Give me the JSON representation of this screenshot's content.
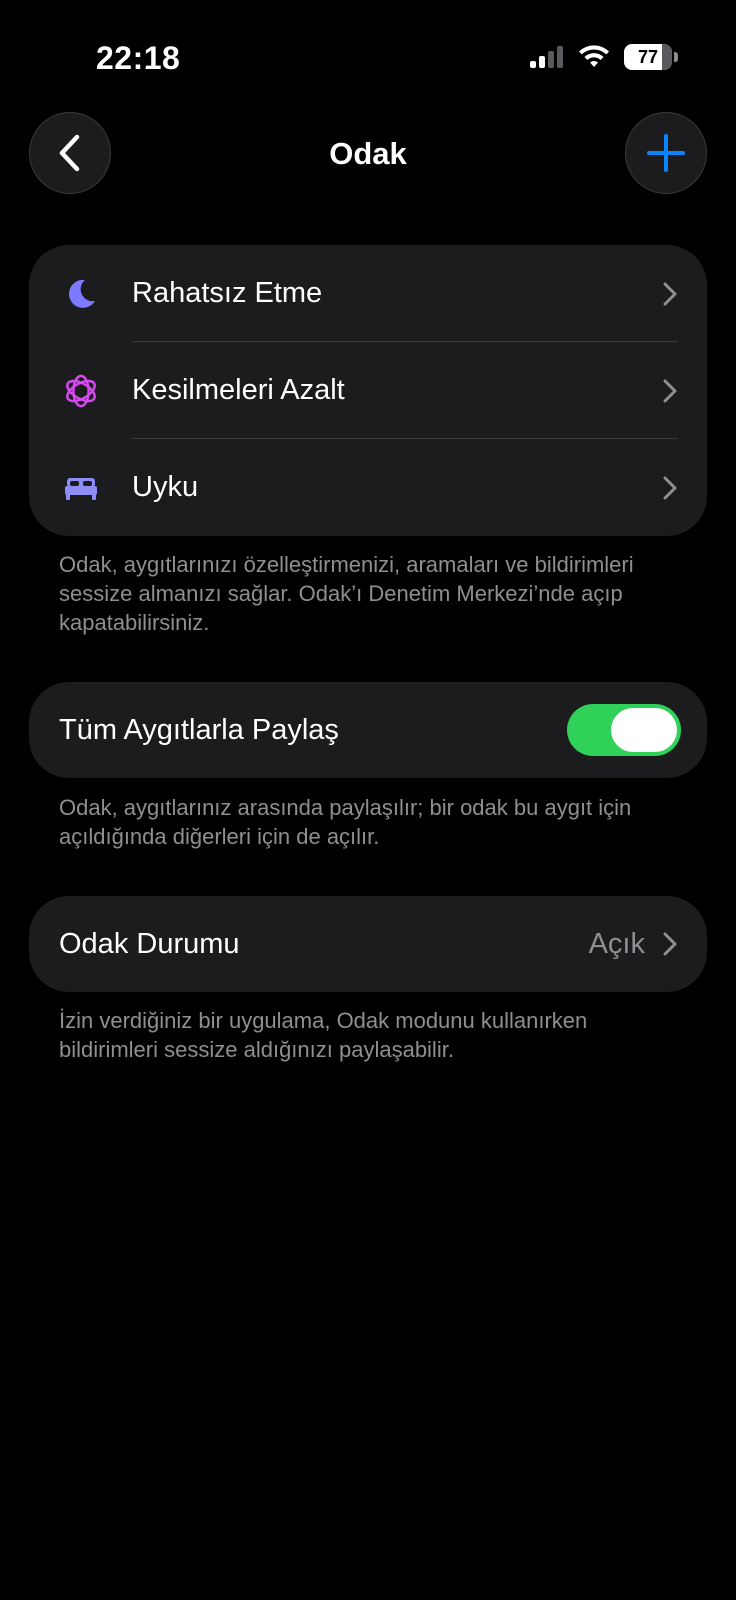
{
  "status_bar": {
    "time": "22:18",
    "battery": "77",
    "icons": [
      "cellular-signal-icon",
      "wifi-icon",
      "battery-icon"
    ]
  },
  "nav": {
    "title": "Odak",
    "back_icon": "chevron-left-icon",
    "add_icon": "plus-icon"
  },
  "focus_modes": [
    {
      "label": "Rahatsız Etme",
      "icon": "moon-icon",
      "icon_color": "#7d7aff"
    },
    {
      "label": "Kesilmeleri Azalt",
      "icon": "flower-icon",
      "icon_color": "#d649f0"
    },
    {
      "label": "Uyku",
      "icon": "bed-icon",
      "icon_color": "#8e8cf5"
    }
  ],
  "focus_footer": "Odak, aygıtlarınızı özelleştirmenizi, aramaları ve bildirimleri sessize almanızı sağlar. Odak’ı Denetim Merkezi’nde açıp kapatabilirsiniz.",
  "share_devices": {
    "label": "Tüm Aygıtlarla Paylaş",
    "enabled": true,
    "footer": "Odak, aygıtlarınız arasında paylaşılır; bir odak bu aygıt için açıldığında diğerleri için de açılır."
  },
  "focus_status": {
    "label": "Odak Durumu",
    "value": "Açık",
    "footer": "İzin verdiğiniz bir uygulama, Odak modunu kullanırken bildirimleri sessize aldığınızı paylaşabilir."
  },
  "colors": {
    "accent_blue": "#0a84ff",
    "toggle_green": "#30d158",
    "background": "#000000",
    "group_background": "#1c1c1e"
  }
}
